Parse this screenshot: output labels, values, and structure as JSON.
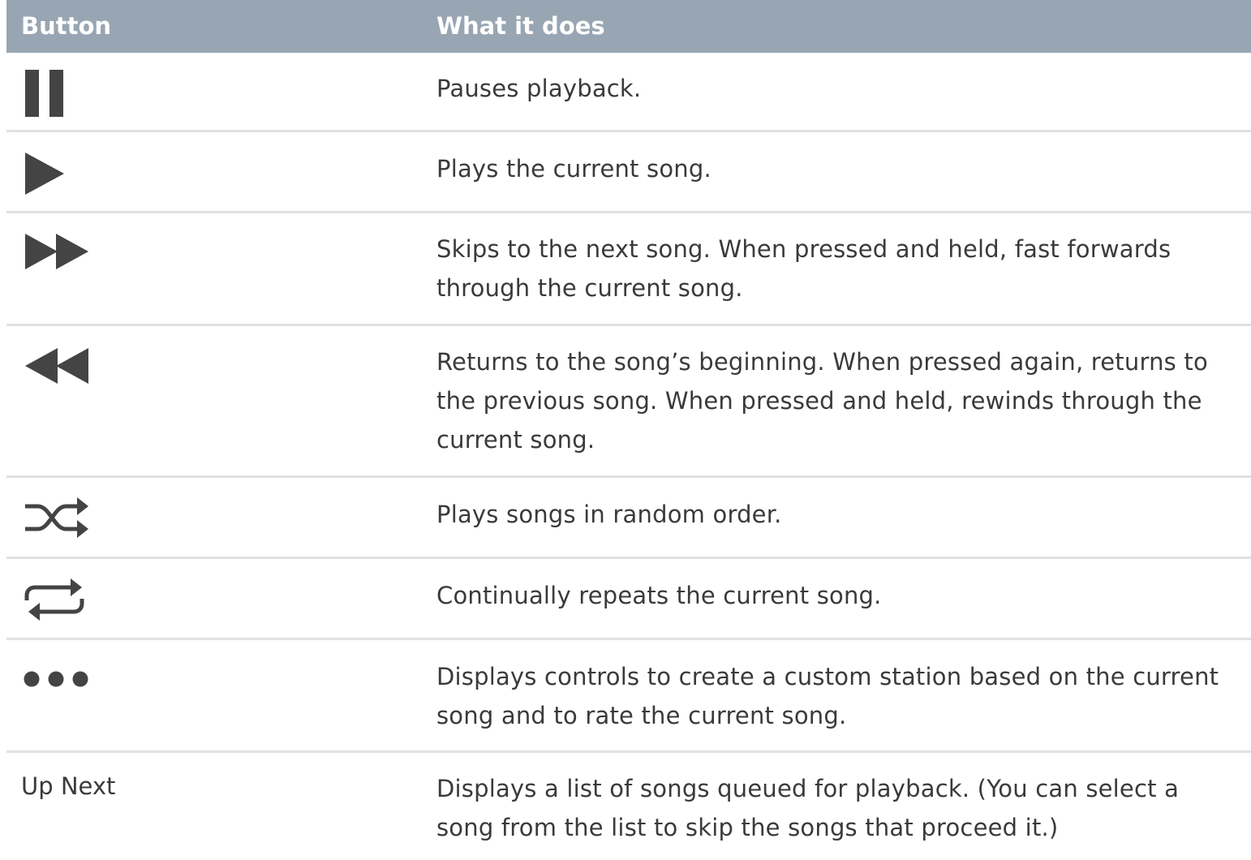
{
  "header": {
    "col_button": "Button",
    "col_what": "What it does"
  },
  "colors": {
    "header_bg": "#98a6b3",
    "icon": "#444444",
    "divider": "#e1e1e1"
  },
  "rows": [
    {
      "icon": "pause-icon",
      "text": "Pauses playback."
    },
    {
      "icon": "play-icon",
      "text": "Plays the current song."
    },
    {
      "icon": "fast-forward-icon",
      "text": "Skips to the next song. When pressed and held, fast forwards through the current song."
    },
    {
      "icon": "rewind-icon",
      "text": "Returns to the song’s beginning. When pressed again, returns to the previous song. When pressed and held, rewinds through the current song."
    },
    {
      "icon": "shuffle-icon",
      "text": "Plays songs in random order."
    },
    {
      "icon": "repeat-icon",
      "text": "Continually repeats the current song."
    },
    {
      "icon": "more-icon",
      "text": "Displays controls to create a custom station based on the current song and to rate the current song."
    },
    {
      "label": "Up Next",
      "text": "Displays a list of songs queued for playback. (You can select a song from the list to skip the songs that proceed it.)"
    }
  ]
}
